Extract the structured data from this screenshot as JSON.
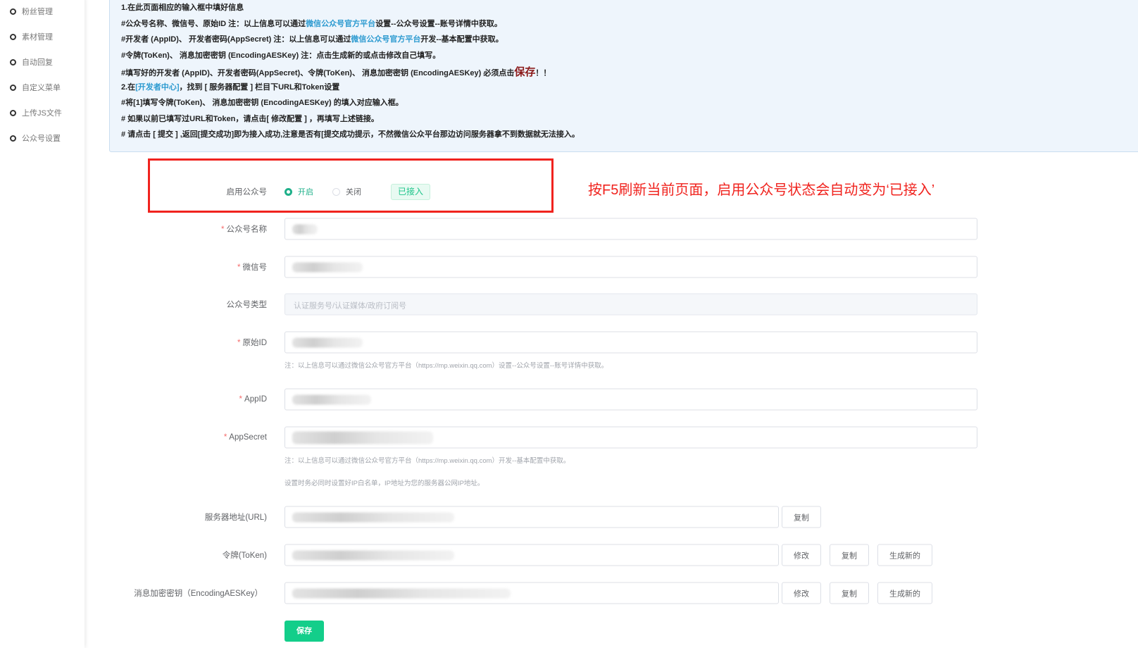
{
  "sidebar": {
    "items": [
      {
        "label": "粉丝管理"
      },
      {
        "label": "素材管理"
      },
      {
        "label": "自动回复"
      },
      {
        "label": "自定义菜单"
      },
      {
        "label": "上传JS文件"
      },
      {
        "label": "公众号设置"
      }
    ]
  },
  "info": {
    "l1": "1.在此页面相应的输入框中填好信息",
    "l2a": "#公众号名称、微信号、原始ID 注：以上信息可以通过",
    "l2link": "微信公众号官方平台",
    "l2b": "设置--公众号设置--账号详情中获取。",
    "l3a": "#开发者 (AppID)、 开发者密码(AppSecret) 注：以上信息可以通过",
    "l3link": "微信公众号官方平台",
    "l3b": "开发--基本配置中获取。",
    "l4": "#令牌(ToKen)、 消息加密密钥 (EncodingAESKey) 注：点击生成新的或点击修改自己填写。",
    "l5a": "#填写好的开发者 (AppID)、开发者密码(AppSecret)、令牌(ToKen)、 消息加密密钥 (EncodingAESKey)  必须点击",
    "l5big": "保存",
    "l5b": "！！",
    "l6a": "2.在",
    "l6link": "[开发者中心]",
    "l6b": "，找到 [ 服务器配置 ] 栏目下URL和Token设置",
    "l7": "#将[1]填写令牌(ToKen)、 消息加密密钥 (EncodingAESKey) 的填入对应输入框。",
    "l8": "# 如果以前已填写过URL和Token，请点击[ 修改配置 ] ，再填写上述链接。",
    "l9": "# 请点击 [ 提交 ] ,返回[提交成功]即为接入成功,注意是否有[提交成功提示，不然微信公众平台那边访问服务器拿不到数据就无法接入。"
  },
  "annotation": "按F5刷新当前页面，启用公众号状态会自动变为‘已接入’",
  "form": {
    "enable_label": "启用公众号",
    "radio_on": "开启",
    "radio_off": "关闭",
    "status_tag": "已接入",
    "name_label": "公众号名称",
    "wechat_label": "微信号",
    "type_label": "公众号类型",
    "type_placeholder": "认证服务号/认证媒体/政府订阅号",
    "origid_label": "原始ID",
    "note1": "注：以上信息可以通过微信公众号官方平台（https://mp.weixin.qq.com）设置--公众号设置--账号详情中获取。",
    "appid_label": "AppID",
    "secret_label": "AppSecret",
    "note2": "注：以上信息可以通过微信公众号官方平台（https://mp.weixin.qq.com）开发--基本配置中获取。",
    "note3": "设置时务必同时设置好IP白名单，IP地址为您的服务器公网IP地址。",
    "url_label": "服务器地址(URL)",
    "token_label": "令牌(ToKen)",
    "aes_label": "消息加密密钥（EncodingAESKey）",
    "copy": "复制",
    "modify": "修改",
    "generate": "生成新的",
    "save": "保存"
  }
}
